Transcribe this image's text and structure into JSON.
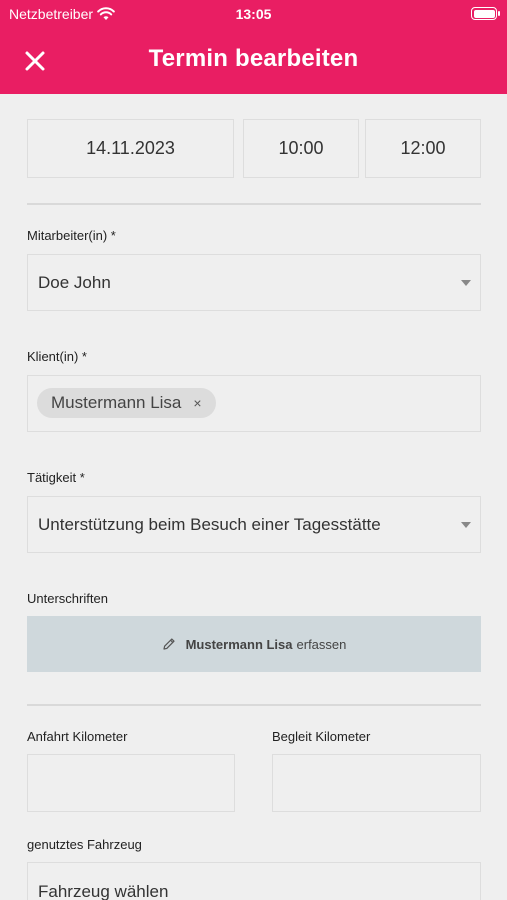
{
  "status_bar": {
    "carrier": "Netzbetreiber",
    "time": "13:05"
  },
  "header": {
    "title": "Termin bearbeiten",
    "close_icon": "close-icon"
  },
  "datetime": {
    "date": "14.11.2023",
    "start": "10:00",
    "end": "12:00"
  },
  "employee": {
    "label": "Mitarbeiter(in) *",
    "value": "Doe John"
  },
  "client": {
    "label": "Klient(in) *",
    "chip": "Mustermann Lisa",
    "chip_remove": "×"
  },
  "activity": {
    "label": "Tätigkeit *",
    "value": "Unterstützung beim Besuch einer Tagesstätte"
  },
  "signatures": {
    "label": "Unterschriften",
    "name": "Mustermann Lisa",
    "action": "erfassen",
    "icon": "pencil-icon"
  },
  "mileage": {
    "arrival_label": "Anfahrt Kilometer",
    "arrival_value": "",
    "escort_label": "Begleit Kilometer",
    "escort_value": ""
  },
  "vehicle": {
    "label": "genutztes Fahrzeug",
    "placeholder": "Fahrzeug wählen"
  },
  "colors": {
    "header": "#e91e63",
    "background": "#efefef",
    "signature_bg": "#cfd8dc"
  }
}
